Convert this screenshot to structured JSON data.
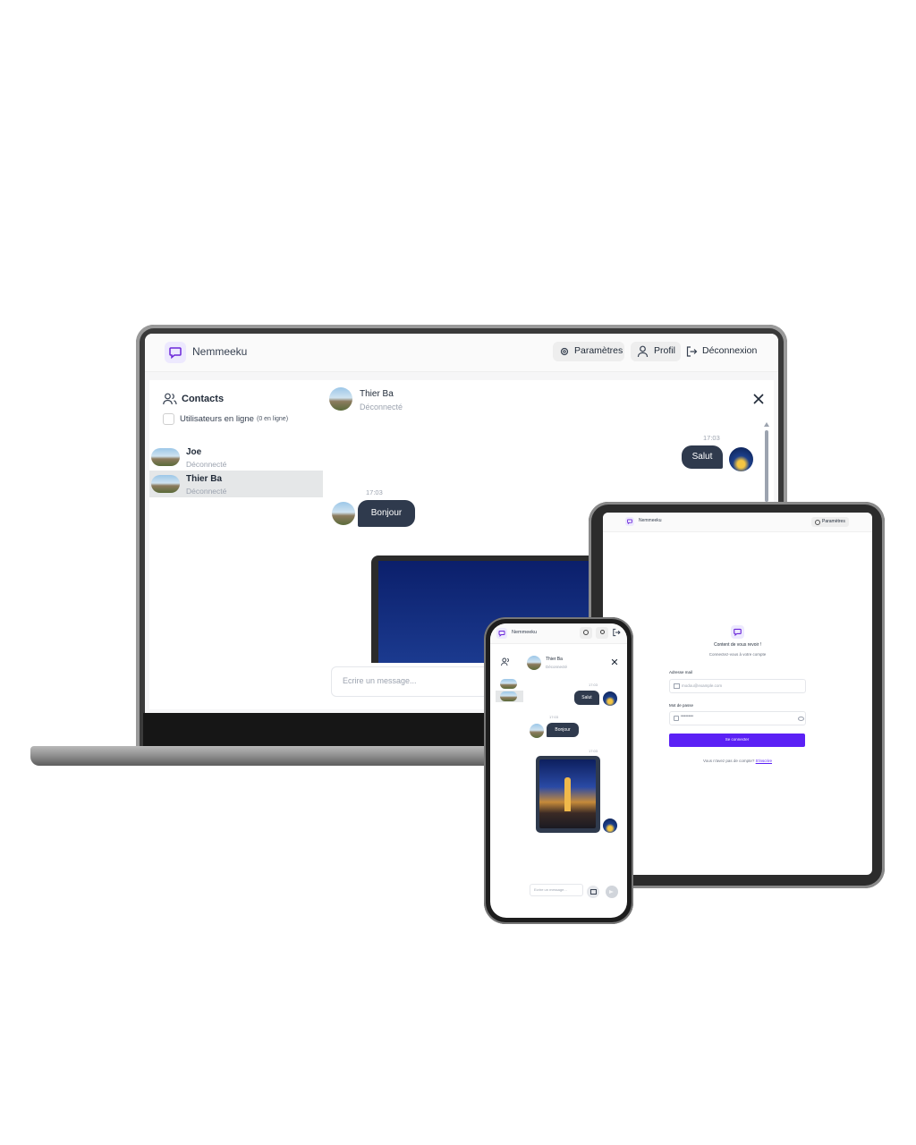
{
  "laptop": {
    "app_name": "Nemmeeku",
    "header": {
      "settings_label": "Paramètres",
      "profile_label": "Profil",
      "logout_label": "Déconnexion"
    },
    "sidebar": {
      "title": "Contacts",
      "online_toggle_label": "Utilisateurs en ligne",
      "online_count": "(0 en ligne)",
      "contacts": [
        {
          "name": "Joe",
          "status": "Déconnecté"
        },
        {
          "name": "Thier Ba",
          "status": "Déconnecté"
        }
      ]
    },
    "chat": {
      "contact_name": "Thier Ba",
      "contact_status": "Déconnecté",
      "messages": [
        {
          "time": "17:03",
          "text": "Salut",
          "direction": "out"
        },
        {
          "time": "17:03",
          "text": "Bonjour",
          "direction": "in"
        }
      ],
      "input_placeholder": "Ecrire un message..."
    }
  },
  "tablet": {
    "app_name": "Nemmeeku",
    "settings_label": "Paramètres",
    "welcome_title": "Content de vous revoir !",
    "welcome_subtitle": "Connectez-vous à votre compte",
    "email_label": "Adresse mail",
    "email_placeholder": "modou@example.com",
    "password_label": "Mot de passe",
    "password_value": "••••••••",
    "submit_label": "Se connecter",
    "signup_prompt": "Vous n'avez pas de compte?",
    "signup_link": "S'inscrire"
  },
  "phone": {
    "app_name": "Nemmeeku",
    "chat": {
      "contact_name": "Thier Ba",
      "contact_status": "Déconnecté",
      "messages": [
        {
          "time": "17:03",
          "text": "Salut",
          "direction": "out"
        },
        {
          "time": "17:03",
          "text": "Bonjour",
          "direction": "in"
        },
        {
          "time": "17:03",
          "text": "",
          "direction": "out",
          "kind": "image"
        }
      ],
      "input_placeholder": "Ecrire un message..."
    }
  },
  "colors": {
    "accent": "#5b21f5",
    "bubble": "#2f3a4d",
    "accent_soft": "#ede9fe"
  }
}
